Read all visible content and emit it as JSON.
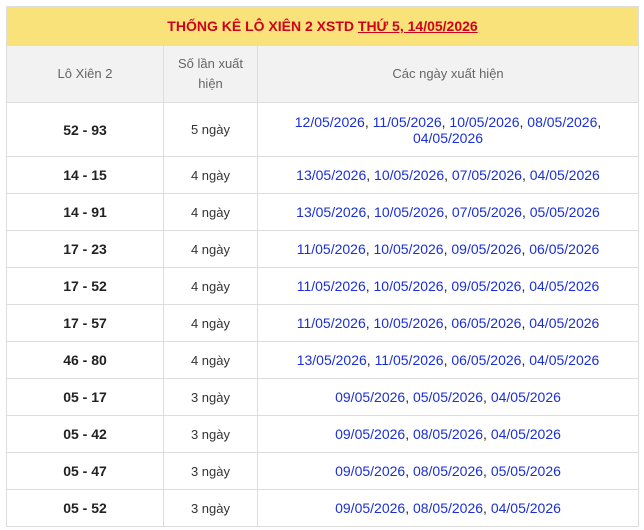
{
  "title": {
    "prefix": "THỐNG KÊ LÔ XIÊN 2 XSTD ",
    "link": "THỨ 5, 14/05/2026"
  },
  "headers": {
    "col1": "Lô Xiên 2",
    "col2": "Số lần xuất hiện",
    "col3": "Các ngày xuất hiện"
  },
  "rows": [
    {
      "pair": "52 - 93",
      "count": "5 ngày",
      "dates": [
        "12/05/2026",
        "11/05/2026",
        "10/05/2026",
        "08/05/2026",
        "04/05/2026"
      ]
    },
    {
      "pair": "14 - 15",
      "count": "4 ngày",
      "dates": [
        "13/05/2026",
        "10/05/2026",
        "07/05/2026",
        "04/05/2026"
      ]
    },
    {
      "pair": "14 - 91",
      "count": "4 ngày",
      "dates": [
        "13/05/2026",
        "10/05/2026",
        "07/05/2026",
        "05/05/2026"
      ]
    },
    {
      "pair": "17 - 23",
      "count": "4 ngày",
      "dates": [
        "11/05/2026",
        "10/05/2026",
        "09/05/2026",
        "06/05/2026"
      ]
    },
    {
      "pair": "17 - 52",
      "count": "4 ngày",
      "dates": [
        "11/05/2026",
        "10/05/2026",
        "09/05/2026",
        "04/05/2026"
      ]
    },
    {
      "pair": "17 - 57",
      "count": "4 ngày",
      "dates": [
        "11/05/2026",
        "10/05/2026",
        "06/05/2026",
        "04/05/2026"
      ]
    },
    {
      "pair": "46 - 80",
      "count": "4 ngày",
      "dates": [
        "13/05/2026",
        "11/05/2026",
        "06/05/2026",
        "04/05/2026"
      ]
    },
    {
      "pair": "05 - 17",
      "count": "3 ngày",
      "dates": [
        "09/05/2026",
        "05/05/2026",
        "04/05/2026"
      ]
    },
    {
      "pair": "05 - 42",
      "count": "3 ngày",
      "dates": [
        "09/05/2026",
        "08/05/2026",
        "04/05/2026"
      ]
    },
    {
      "pair": "05 - 47",
      "count": "3 ngày",
      "dates": [
        "09/05/2026",
        "08/05/2026",
        "05/05/2026"
      ]
    },
    {
      "pair": "05 - 52",
      "count": "3 ngày",
      "dates": [
        "09/05/2026",
        "08/05/2026",
        "04/05/2026"
      ]
    }
  ],
  "colors": {
    "title_bg": "#fae27a",
    "title_text": "#d0021b",
    "header_bg": "#f2f2f2",
    "date_link": "#1a2fd6"
  }
}
